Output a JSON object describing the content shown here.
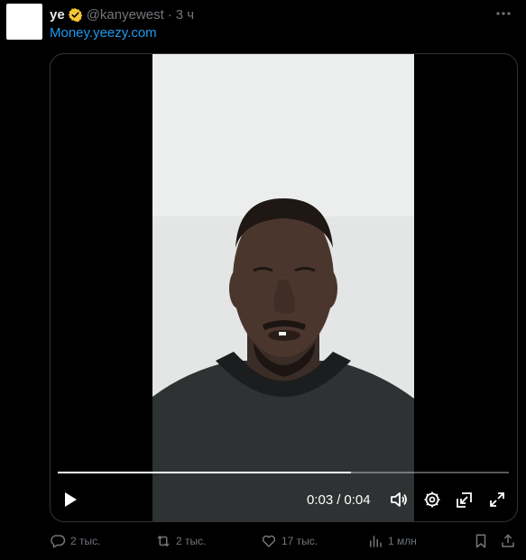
{
  "tweet": {
    "display_name": "ye",
    "handle": "@kanyewest",
    "separator": "·",
    "time": "3 ч",
    "link_text": "Money.yeezy.com"
  },
  "video": {
    "current_time": "0:03",
    "divider": "/",
    "duration": "0:04",
    "progress": 0.65
  },
  "actions": {
    "replies": "2 тыс.",
    "reposts": "2 тыс.",
    "likes": "17 тыс.",
    "views": "1 млн"
  },
  "colors": {
    "background": "#000000",
    "link": "#1d9bf0",
    "muted": "#71767b",
    "verified_badge": "#f4c534"
  }
}
